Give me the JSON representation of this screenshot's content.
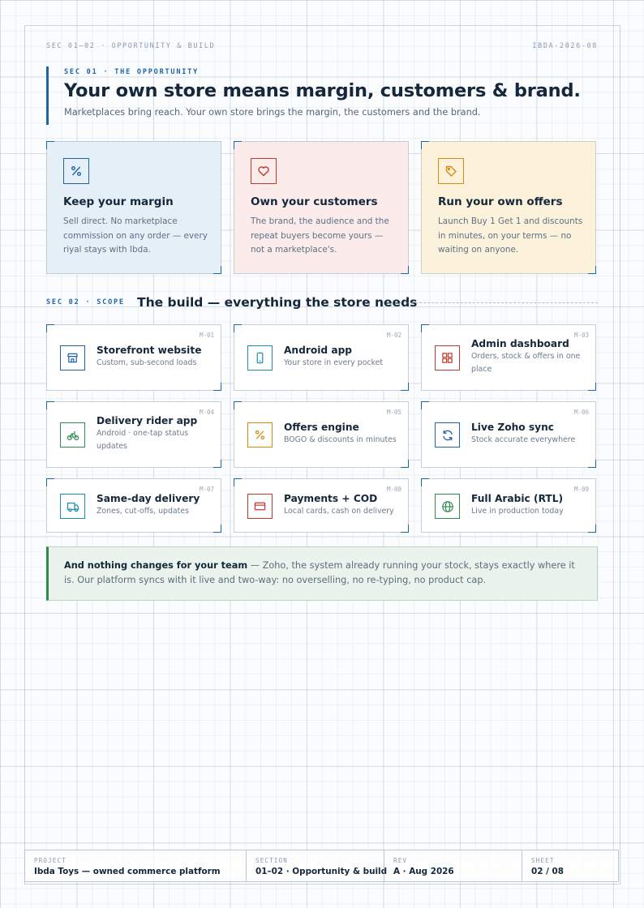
{
  "header": {
    "section_ref": "SEC 01–02 · OPPORTUNITY & BUILD",
    "doc_id": "IBDA-2026-08"
  },
  "opportunity": {
    "eyebrow": "SEC 01 · THE OPPORTUNITY",
    "title": "Your own store means margin, customers & brand.",
    "subtitle": "Marketplaces bring reach. Your own store brings the margin, the customers and the brand.",
    "cards": [
      {
        "icon": "percent-icon",
        "title": "Keep your margin",
        "body": "Sell direct. No marketplace commission on any order — every riyal stays with Ibda.",
        "bg": "#e4eff8",
        "accent": "#1f63a8"
      },
      {
        "icon": "heart-icon",
        "title": "Own your customers",
        "body": "The brand, the audience and the repeat buyers become yours — not a marketplace's.",
        "bg": "#fbeceb",
        "accent": "#c0392b"
      },
      {
        "icon": "tag-icon",
        "title": "Run your own offers",
        "body": "Launch Buy 1 Get 1 and discounts in minutes, on your terms — no waiting on anyone.",
        "bg": "#fcf2dc",
        "accent": "#d68a10"
      }
    ]
  },
  "scope": {
    "eyebrow": "SEC 02 · SCOPE",
    "title": "The build — everything the store needs",
    "modules": [
      {
        "code": "M-01",
        "icon": "storefront-icon",
        "title": "Storefront website",
        "sub": "Custom, sub-second loads",
        "accent": "#1f63a8"
      },
      {
        "code": "M-02",
        "icon": "phone-icon",
        "title": "Android app",
        "sub": "Your store in every pocket",
        "accent": "#1a8fae"
      },
      {
        "code": "M-03",
        "icon": "grid-icon",
        "title": "Admin dashboard",
        "sub": "Orders, stock & offers in one place",
        "accent": "#c0392b"
      },
      {
        "code": "M-04",
        "icon": "bike-icon",
        "title": "Delivery rider app",
        "sub": "Android · one-tap status updates",
        "accent": "#2f8a4e"
      },
      {
        "code": "M-05",
        "icon": "percent-icon",
        "title": "Offers engine",
        "sub": "BOGO & discounts in minutes",
        "accent": "#d68a10"
      },
      {
        "code": "M-06",
        "icon": "sync-icon",
        "title": "Live Zoho sync",
        "sub": "Stock accurate everywhere",
        "accent": "#1f63a8"
      },
      {
        "code": "M-07",
        "icon": "truck-icon",
        "title": "Same-day delivery",
        "sub": "Zones, cut-offs, updates",
        "accent": "#1a8fae"
      },
      {
        "code": "M-08",
        "icon": "card-icon",
        "title": "Payments + COD",
        "sub": "Local cards, cash on delivery",
        "accent": "#c0392b"
      },
      {
        "code": "M-09",
        "icon": "globe-icon",
        "title": "Full Arabic (RTL)",
        "sub": "Live in production today",
        "accent": "#2f8a4e"
      }
    ]
  },
  "note": {
    "lead": "And nothing changes for your team",
    "text": " — Zoho, the system already running your stock, stays exactly where it is. Our platform syncs with it live and two-way: no overselling, no re-typing, no product cap."
  },
  "titleblock": {
    "project_label": "PROJECT",
    "project_value": "Ibda Toys — owned commerce platform",
    "section_label": "SECTION",
    "section_value": "01–02 · Opportunity & build",
    "rev_label": "REV",
    "rev_value": "A · Aug 2026",
    "sheet_label": "SHEET",
    "sheet_value": "02 / 08"
  }
}
